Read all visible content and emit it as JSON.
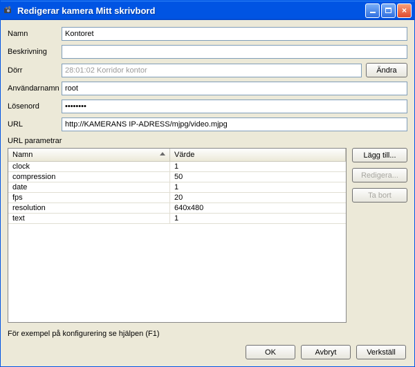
{
  "window": {
    "title": "Redigerar kamera Mitt skrivbord"
  },
  "labels": {
    "name": "Namn",
    "description": "Beskrivning",
    "door": "Dörr",
    "change": "Ändra",
    "username": "Användarnamn",
    "password": "Lösenord",
    "url": "URL",
    "url_params": "URL parametrar",
    "col_name": "Namn",
    "col_value": "Värde",
    "add": "Lägg till...",
    "edit": "Redigera...",
    "delete": "Ta bort",
    "help": "För exempel på konfigurering se hjälpen (F1)",
    "ok": "OK",
    "cancel": "Avbryt",
    "apply": "Verkställ"
  },
  "fields": {
    "name": "Kontoret",
    "description": "",
    "door": "28:01:02 Korridor kontor",
    "username": "root",
    "password": "••••••••",
    "url": "http://KAMERANS IP-ADRESS/mjpg/video.mjpg"
  },
  "params": [
    {
      "name": "clock",
      "value": "1"
    },
    {
      "name": "compression",
      "value": "50"
    },
    {
      "name": "date",
      "value": "1"
    },
    {
      "name": "fps",
      "value": "20"
    },
    {
      "name": "resolution",
      "value": "640x480"
    },
    {
      "name": "text",
      "value": "1"
    }
  ]
}
